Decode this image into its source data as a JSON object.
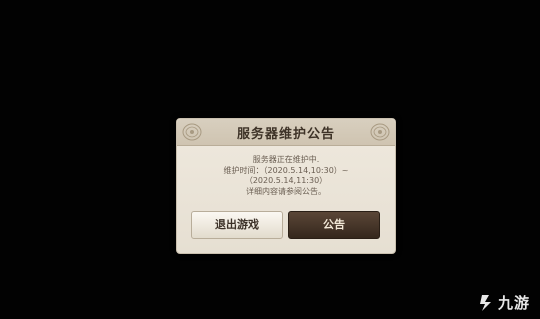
{
  "dialog": {
    "title": "服务器维护公告",
    "lines": [
      "服务器正在维护中.",
      "维护时间：（2020.5.14,10:30）~",
      "（2020.5.14,11:30）",
      "详细内容请参阅公告。"
    ],
    "exit_label": "退出游戏",
    "notice_label": "公告"
  },
  "watermark": {
    "text": "九游",
    "logo_icon": "jiuyou-logo-icon"
  },
  "colors": {
    "background": "#000000",
    "dialog_bg": "#efe9de",
    "primary_button": "#3f2f22"
  }
}
